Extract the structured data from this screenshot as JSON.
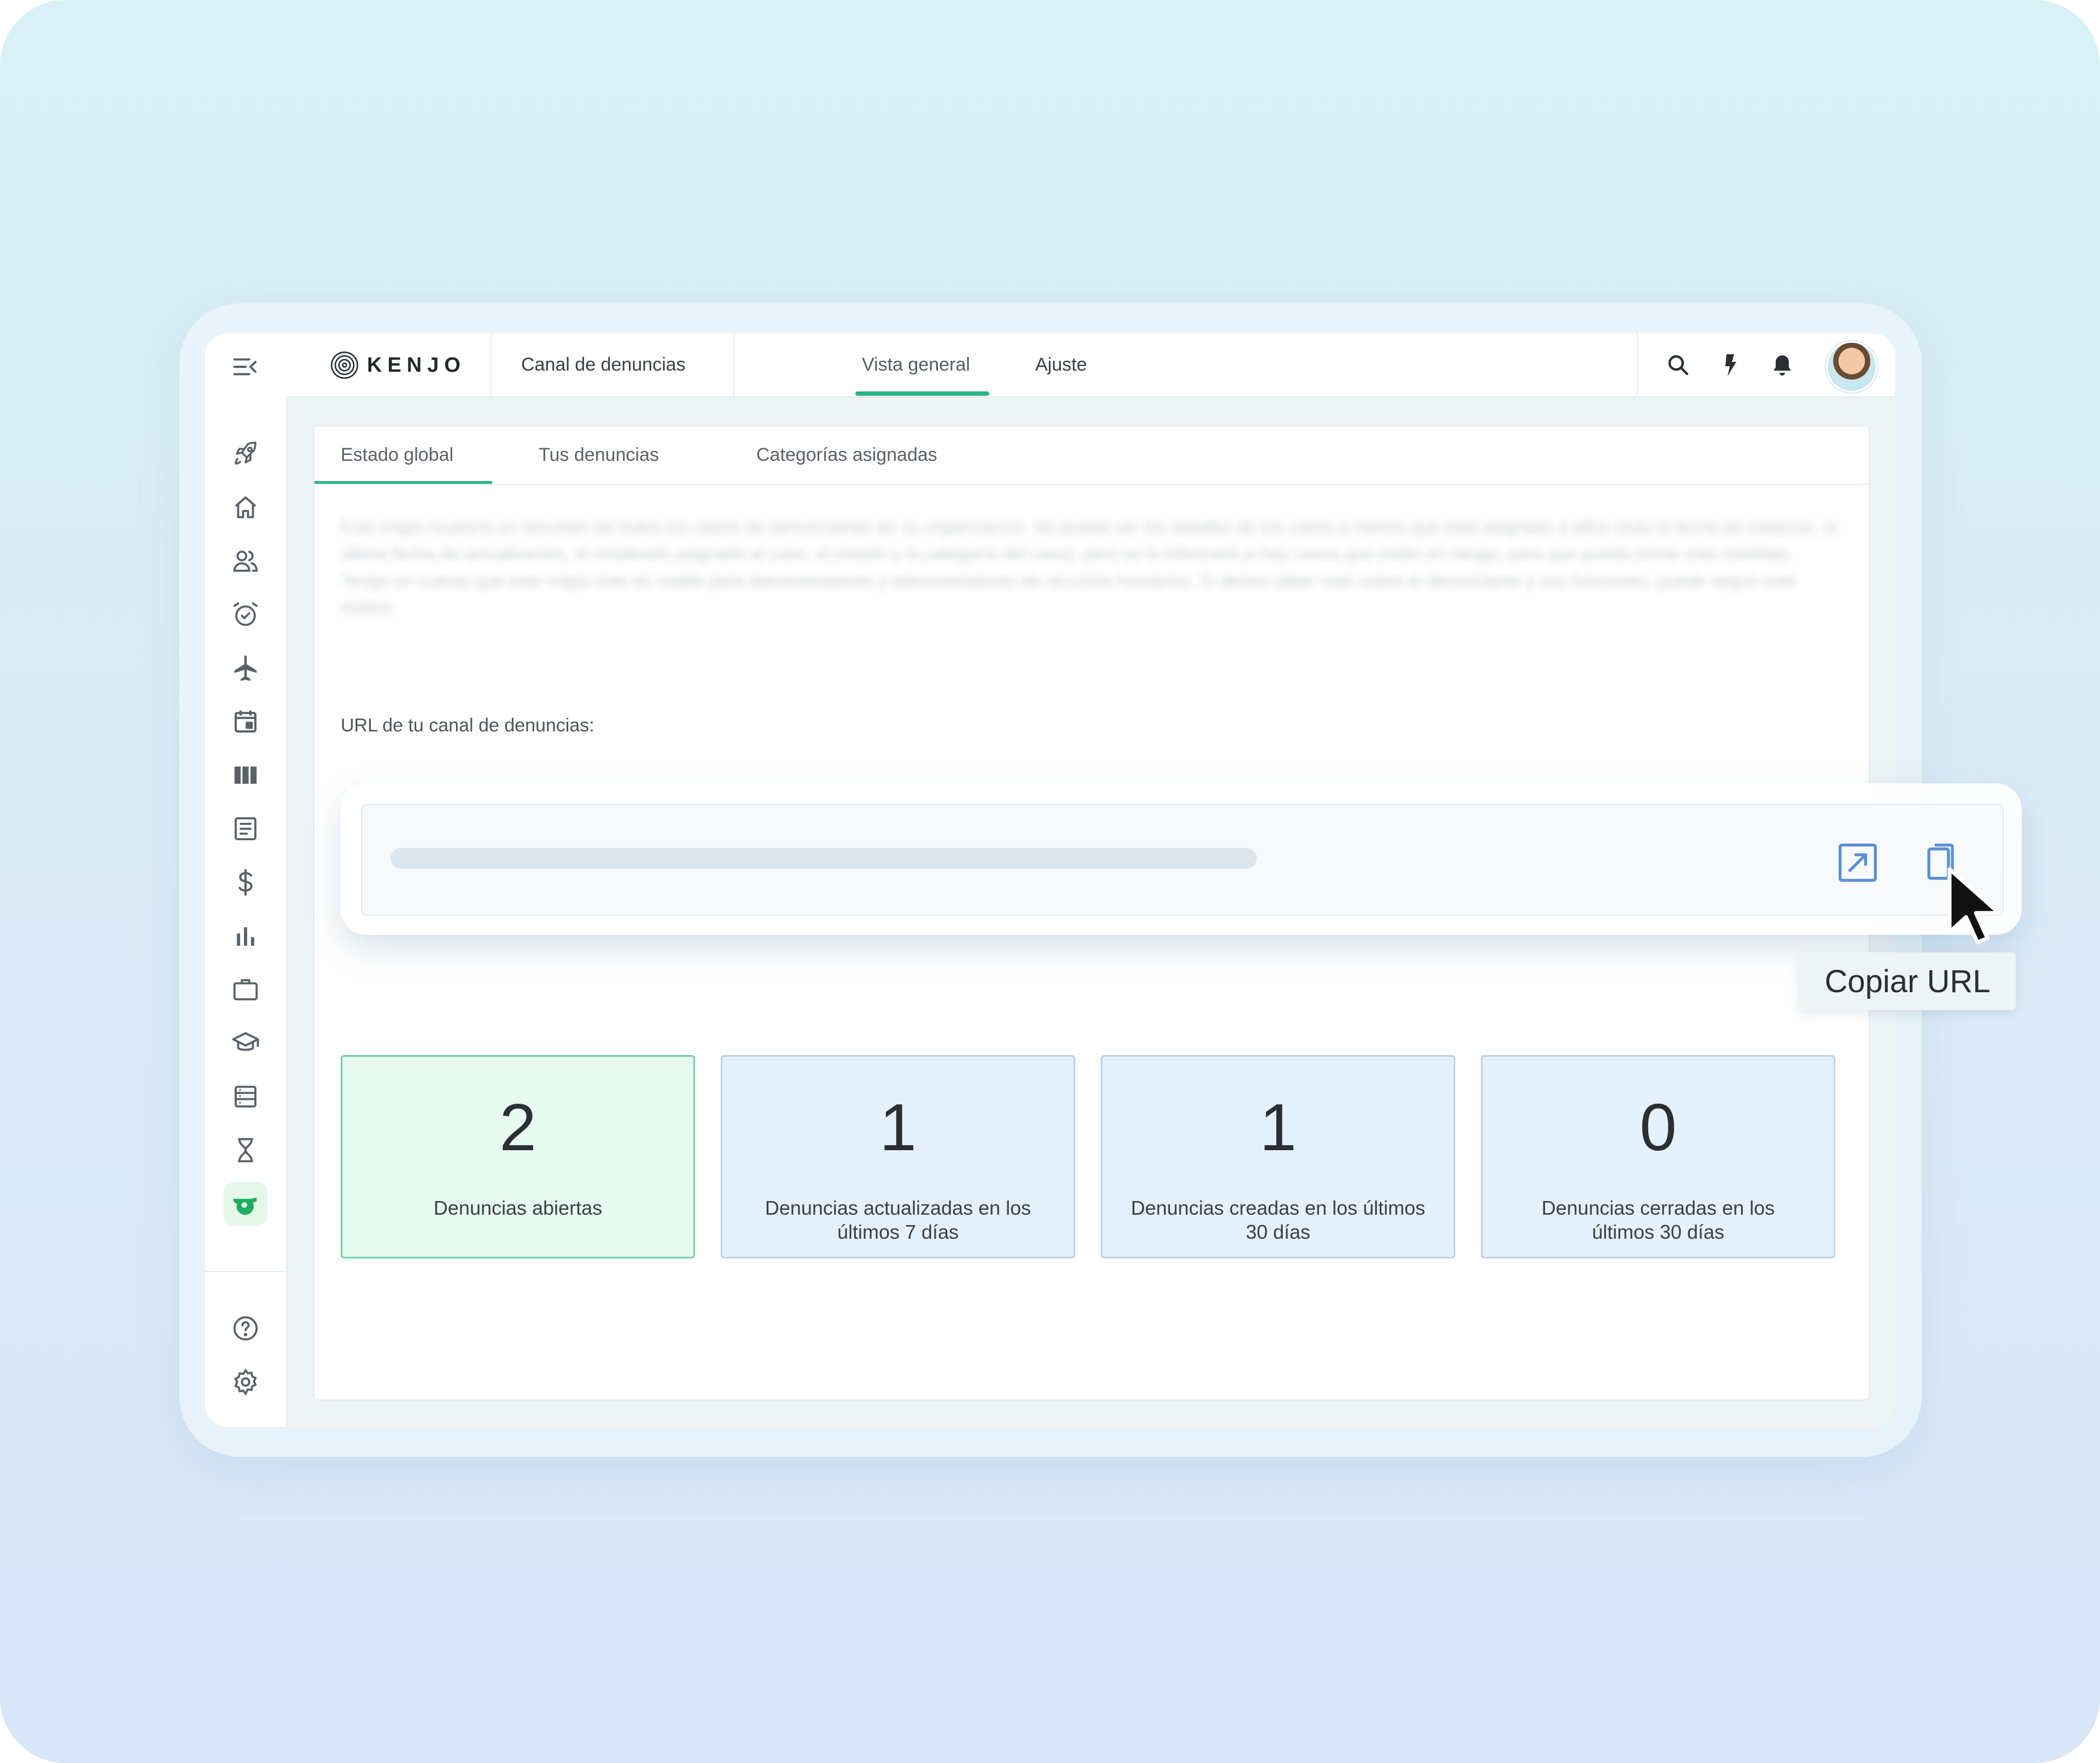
{
  "brand": {
    "name": "KENJO"
  },
  "nav": {
    "tabs": [
      {
        "label": "Canal de denuncias"
      },
      {
        "label": "Vista general",
        "active": true
      },
      {
        "label": "Ajuste"
      }
    ]
  },
  "subtabs": [
    {
      "label": "Estado global",
      "active": true
    },
    {
      "label": "Tus denuncias"
    },
    {
      "label": "Categorías asignadas"
    }
  ],
  "intro_text": "Este mapa muestra un resumen de todos los casos de denunciantes en su organización. No puede ver los detalles de los casos a menos que esté asignado a ellos (solo la fecha de creación, la última fecha de actualización, el empleado asignado al caso, el estado y la categoría del caso), pero se le informará si hay casos que están en riesgo, para que pueda tomar más medidas. Tenga en cuenta que este mapa solo es visible para administradores y administradores de recursos humanos. Si desea saber más sobre el denunciante y sus funciones, puede seguir este enlace.",
  "url_section": {
    "label": "URL de tu canal de denuncias:"
  },
  "tooltip": {
    "copy": "Copiar URL"
  },
  "stats": [
    {
      "value": "2",
      "label": "Denuncias abiertas",
      "highlight": true
    },
    {
      "value": "1",
      "label": "Denuncias actualizadas en los últimos 7 días"
    },
    {
      "value": "1",
      "label": "Denuncias creadas en los últimos 30 días"
    },
    {
      "value": "0",
      "label": "Denuncias cerradas en los últimos 30 días"
    }
  ],
  "colors": {
    "accent": "#27b783",
    "tile_blue": "#e4f1fc",
    "tile_green": "#e6faf0",
    "icon_blue": "#5b8fd6"
  },
  "sidebar_icons": [
    "menu-collapse-icon",
    "rocket-icon",
    "home-icon",
    "people-icon",
    "alarm-clock-icon",
    "airplane-icon",
    "calendar-icon",
    "columns-icon",
    "document-icon",
    "dollar-icon",
    "bar-chart-icon",
    "briefcase-icon",
    "graduation-cap-icon",
    "server-list-icon",
    "hourglass-icon",
    "whistle-icon",
    "help-icon",
    "gear-icon"
  ]
}
